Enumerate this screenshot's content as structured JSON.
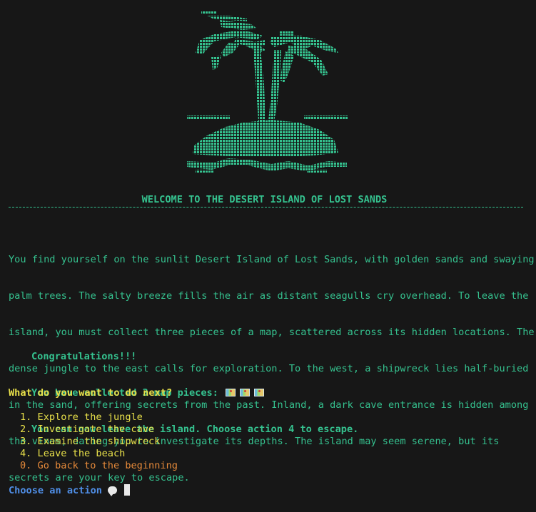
{
  "header": {
    "title": "WELCOME TO THE DESERT ISLAND OF LOST SANDS"
  },
  "story": {
    "lines": [
      "You find yourself on the sunlit Desert Island of Lost Sands, with golden sands and swaying",
      "palm trees. The salty breeze fills the air as distant seagulls cry overhead. To leave the",
      "island, you must collect three pieces of a map, scattered across its hidden locations. The",
      "dense jungle to the east calls for exploration. To the west, a shipwreck lies half-buried",
      "in the sand, offering secrets from the past. Inland, a dark cave entrance is hidden among",
      "the vines, daring you to investigate its depths. The island may seem serene, but its",
      "secrets are your key to escape."
    ]
  },
  "status": {
    "congrats": "Congratulations!!!",
    "collected": "You have collected 3 map pieces:",
    "map_pieces_count": 3,
    "map_icon": "world-map-icon",
    "escape_hint": "You can now leave the island. Choose action 4 to escape."
  },
  "prompt": {
    "question": "What do you want to do next?"
  },
  "menu": {
    "items": [
      {
        "label": "1. Explore the jungle"
      },
      {
        "label": "2. Investigate the cave"
      },
      {
        "label": "3. Examine the shipwreck"
      },
      {
        "label": "4. Leave the beach"
      },
      {
        "label": "0. Go back to the beginning"
      }
    ]
  },
  "input": {
    "label": "Choose an action",
    "icon": "speech-bubble-icon"
  },
  "colors": {
    "background": "#171717",
    "text_green": "#35c28f",
    "menu_yellow": "#e8e04a",
    "back_orange": "#e68a3a",
    "prompt_blue": "#4f8ee6"
  }
}
